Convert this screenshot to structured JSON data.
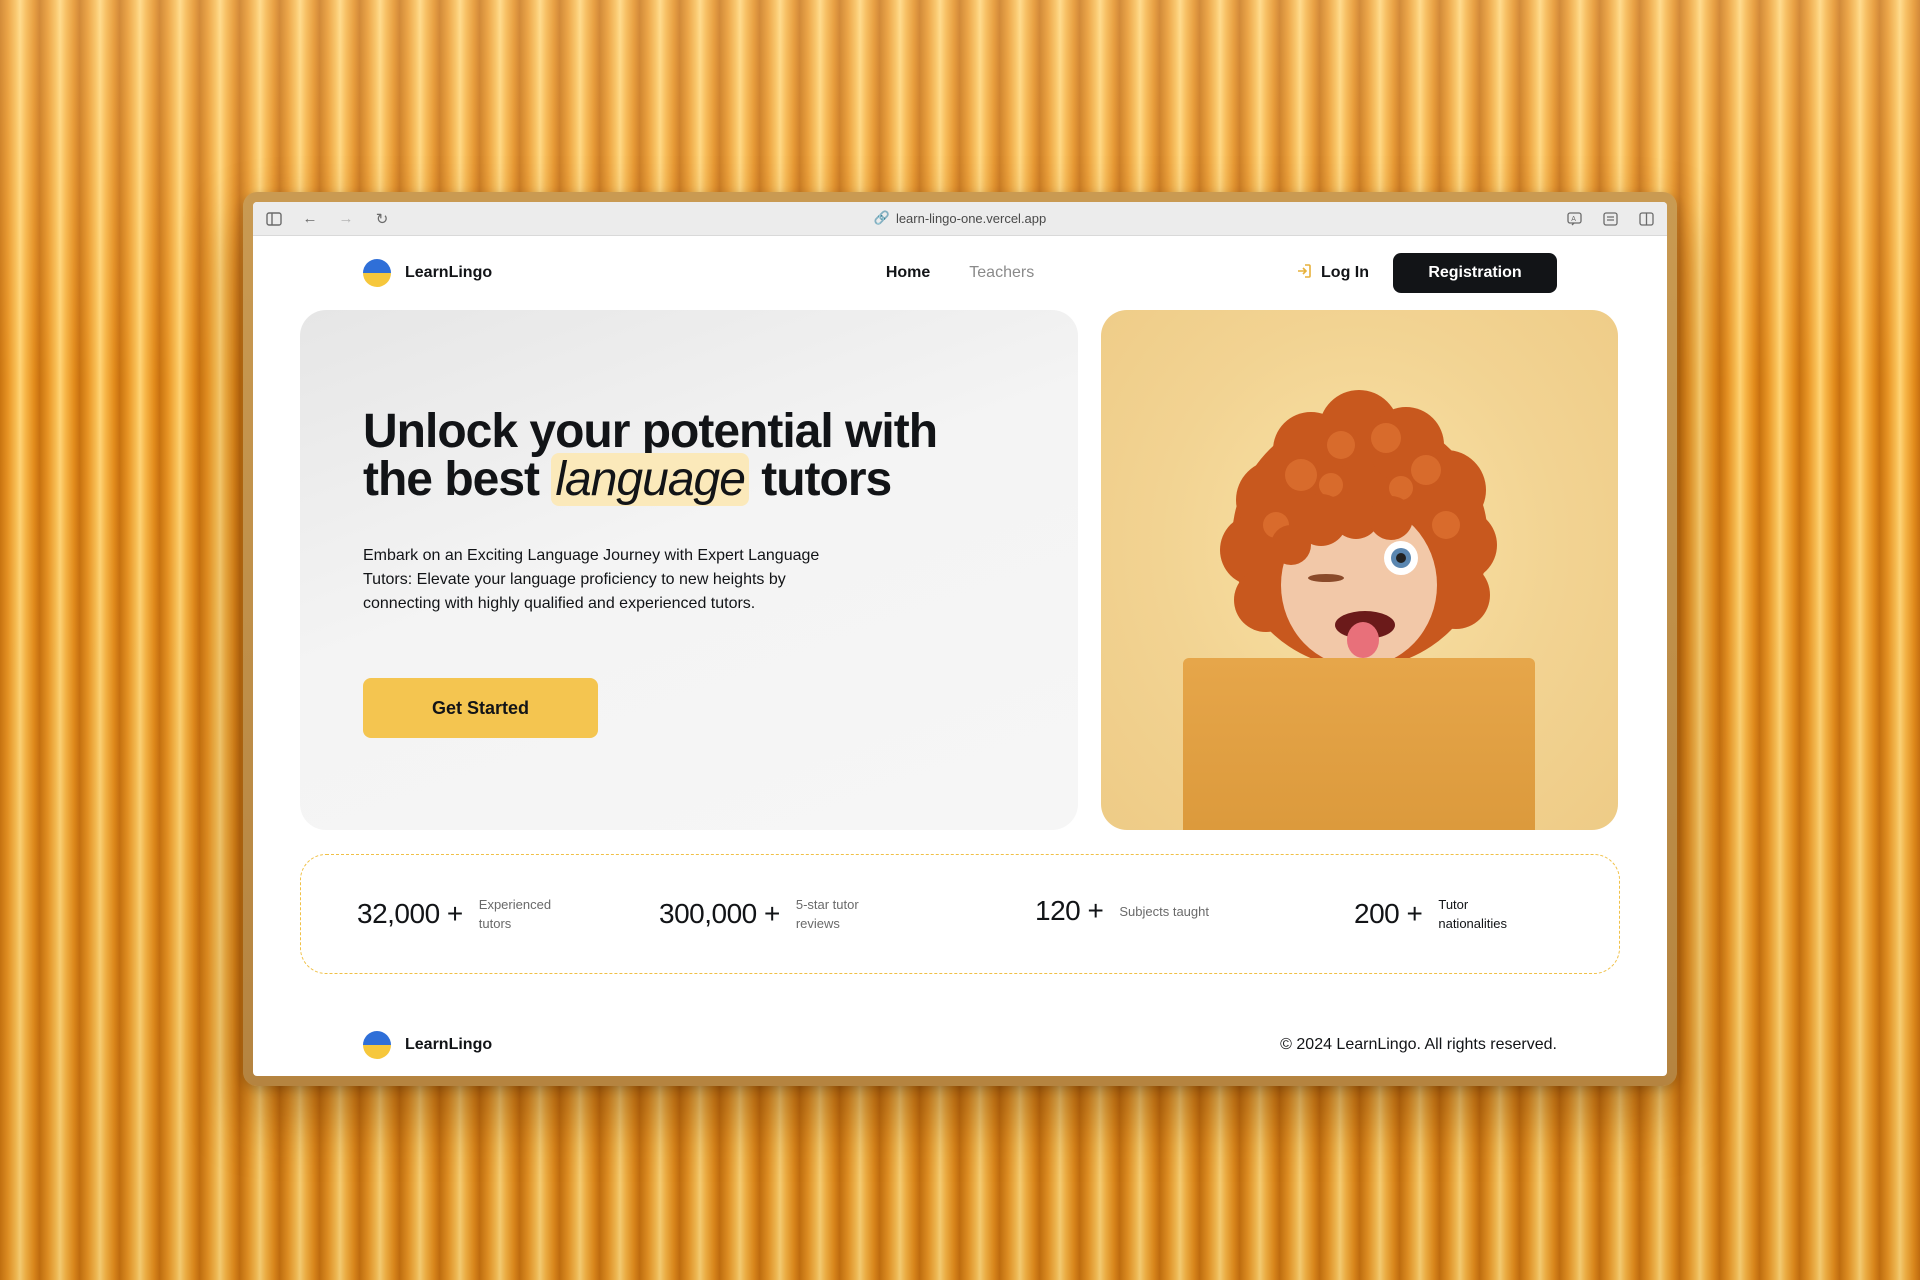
{
  "browser": {
    "url": "learn-lingo-one.vercel.app",
    "icons": [
      "sidebar-icon",
      "back-icon",
      "forward-icon",
      "reload-icon",
      "link-icon",
      "translate-icon",
      "reader-icon",
      "split-view-icon"
    ]
  },
  "nav": {
    "brand": "LearnLingo",
    "links": {
      "home": "Home",
      "teachers": "Teachers"
    },
    "login": "Log In",
    "registration": "Registration"
  },
  "hero": {
    "headline_part1": "Unlock your potential with",
    "headline_part2": "the best",
    "headline_highlight": "language",
    "headline_part3": "tutors",
    "subtext": "Embark on an Exciting Language Journey with Expert Language Tutors: Elevate your language proficiency to new heights by connecting with highly qualified and experienced tutors.",
    "cta": "Get Started"
  },
  "stats": [
    {
      "value": "32,000 +",
      "label": "Experienced tutors"
    },
    {
      "value": "300,000 +",
      "label": "5-star tutor reviews"
    },
    {
      "value": "120 +",
      "label": "Subjects taught"
    },
    {
      "value": "200 +",
      "label": "Tutor nationalities"
    }
  ],
  "footer": {
    "brand": "LearnLingo",
    "copyright": "© 2024 LearnLingo. All rights reserved."
  },
  "colors": {
    "accent": "#F4C550",
    "dark": "#121417",
    "highlight": "#FBE9BA",
    "flag_blue": "#2F6FD8",
    "flag_yellow": "#F6C73C"
  }
}
